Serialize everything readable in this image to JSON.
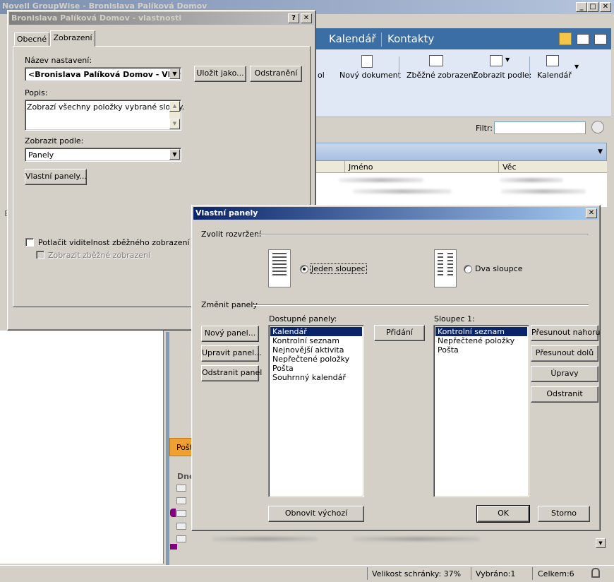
{
  "main_window": {
    "title": "Novell GroupWise - Bronislava Palíková Domov",
    "nav_tabs": [
      {
        "label": "Kalendář"
      },
      {
        "label": "Kontakty"
      }
    ],
    "toolbar": {
      "partial_label": "ol",
      "new_document": "Nový dokument",
      "quick_view": "Zběžné zobrazení",
      "display_by": "Zobrazit podle:",
      "calendar": "Kalendář"
    },
    "filter_label": "Filtr:",
    "filter_value": "",
    "list_columns": [
      "Jméno",
      "Věc"
    ],
    "lower_tab_partial": "Pošt",
    "lower_group_partial": "Dne",
    "status_bar": {
      "mailbox_size": "Velikost schránky: 37%",
      "selected": "Vybráno:1",
      "total": "Celkem:6"
    },
    "left_letter": "B"
  },
  "props_dialog": {
    "title": "Bronislava Palíková Domov - vlastnosti",
    "tabs": [
      {
        "label": "Obecné"
      },
      {
        "label": "Zobrazení"
      }
    ],
    "setting_name_label": "Název nastavení:",
    "setting_name_value": "<Bronislava Palíková Domov - Vlastní>",
    "save_as": "Uložit jako...",
    "remove": "Odstranění",
    "description_label": "Popis:",
    "description_value": "Zobrazí všechny položky vybrané složky.",
    "display_by_label": "Zobrazit podle:",
    "display_by_value": "Panely",
    "custom_panels_button": "Vlastní panely...",
    "suppress_quick_view": "Potlačit viditelnost zběžného zobrazení",
    "show_quick_view": "Zobrazit zběžné zobrazení"
  },
  "panels_dialog": {
    "title": "Vlastní panely",
    "layout_section": "Zvolit rozvržení",
    "one_column": "Jeden sloupec",
    "two_columns": "Dva sloupce",
    "change_panels_section": "Změnit panely",
    "new_panel": "Nový panel...",
    "edit_panel": "Upravit panel...",
    "delete_panel": "Odstranit panel",
    "available_label": "Dostupné panely:",
    "available_items": [
      {
        "label": "Kalendář"
      },
      {
        "label": "Kontrolní seznam"
      },
      {
        "label": "Nejnovější aktivita"
      },
      {
        "label": "Nepřečtené položky"
      },
      {
        "label": "Pošta"
      },
      {
        "label": "Souhrnný kalendář"
      }
    ],
    "add_button": "Přidání",
    "column_label": "Sloupec 1:",
    "column_items": [
      {
        "label": "Kontrolní seznam"
      },
      {
        "label": "Nepřečtené položky"
      },
      {
        "label": "Pošta"
      }
    ],
    "move_up": "Přesunout nahoru",
    "move_down": "Přesunout dolů",
    "edit": "Úpravy",
    "delete": "Odstranit",
    "restore_default": "Obnovit výchozí",
    "ok": "OK",
    "cancel": "Storno"
  },
  "colors": {
    "nav_blue": "#3a6ea5",
    "active_title": "#0a246a",
    "accent_orange": "#f0a030"
  }
}
